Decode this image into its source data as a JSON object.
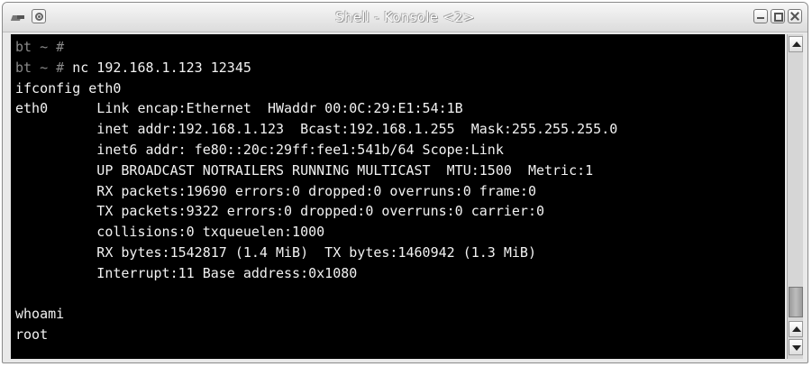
{
  "window": {
    "title": "Shell - Konsole <2>"
  },
  "terminal": {
    "lines": [
      {
        "prompt": "bt ~ #",
        "text": ""
      },
      {
        "prompt": "bt ~ #",
        "text": " nc 192.168.1.123 12345"
      },
      {
        "prompt": "",
        "text": "ifconfig eth0"
      },
      {
        "prompt": "",
        "text": "eth0      Link encap:Ethernet  HWaddr 00:0C:29:E1:54:1B"
      },
      {
        "prompt": "",
        "text": "          inet addr:192.168.1.123  Bcast:192.168.1.255  Mask:255.255.255.0"
      },
      {
        "prompt": "",
        "text": "          inet6 addr: fe80::20c:29ff:fee1:541b/64 Scope:Link"
      },
      {
        "prompt": "",
        "text": "          UP BROADCAST NOTRAILERS RUNNING MULTICAST  MTU:1500  Metric:1"
      },
      {
        "prompt": "",
        "text": "          RX packets:19690 errors:0 dropped:0 overruns:0 frame:0"
      },
      {
        "prompt": "",
        "text": "          TX packets:9322 errors:0 dropped:0 overruns:0 carrier:0"
      },
      {
        "prompt": "",
        "text": "          collisions:0 txqueuelen:1000"
      },
      {
        "prompt": "",
        "text": "          RX bytes:1542817 (1.4 MiB)  TX bytes:1460942 (1.3 MiB)"
      },
      {
        "prompt": "",
        "text": "          Interrupt:11 Base address:0x1080"
      },
      {
        "prompt": "",
        "text": ""
      },
      {
        "prompt": "",
        "text": "whoami"
      },
      {
        "prompt": "",
        "text": "root"
      }
    ]
  },
  "colors": {
    "terminal_bg": "#000000",
    "terminal_fg": "#f2f2f2",
    "prompt": "#8a8a8a"
  },
  "icons": {
    "app": "konsole-icon",
    "menu": "window-menu-icon",
    "minimize": "minimize-icon",
    "maximize": "maximize-icon",
    "close": "close-icon",
    "scroll_up": "arrow-up-icon",
    "scroll_down": "arrow-down-icon"
  }
}
